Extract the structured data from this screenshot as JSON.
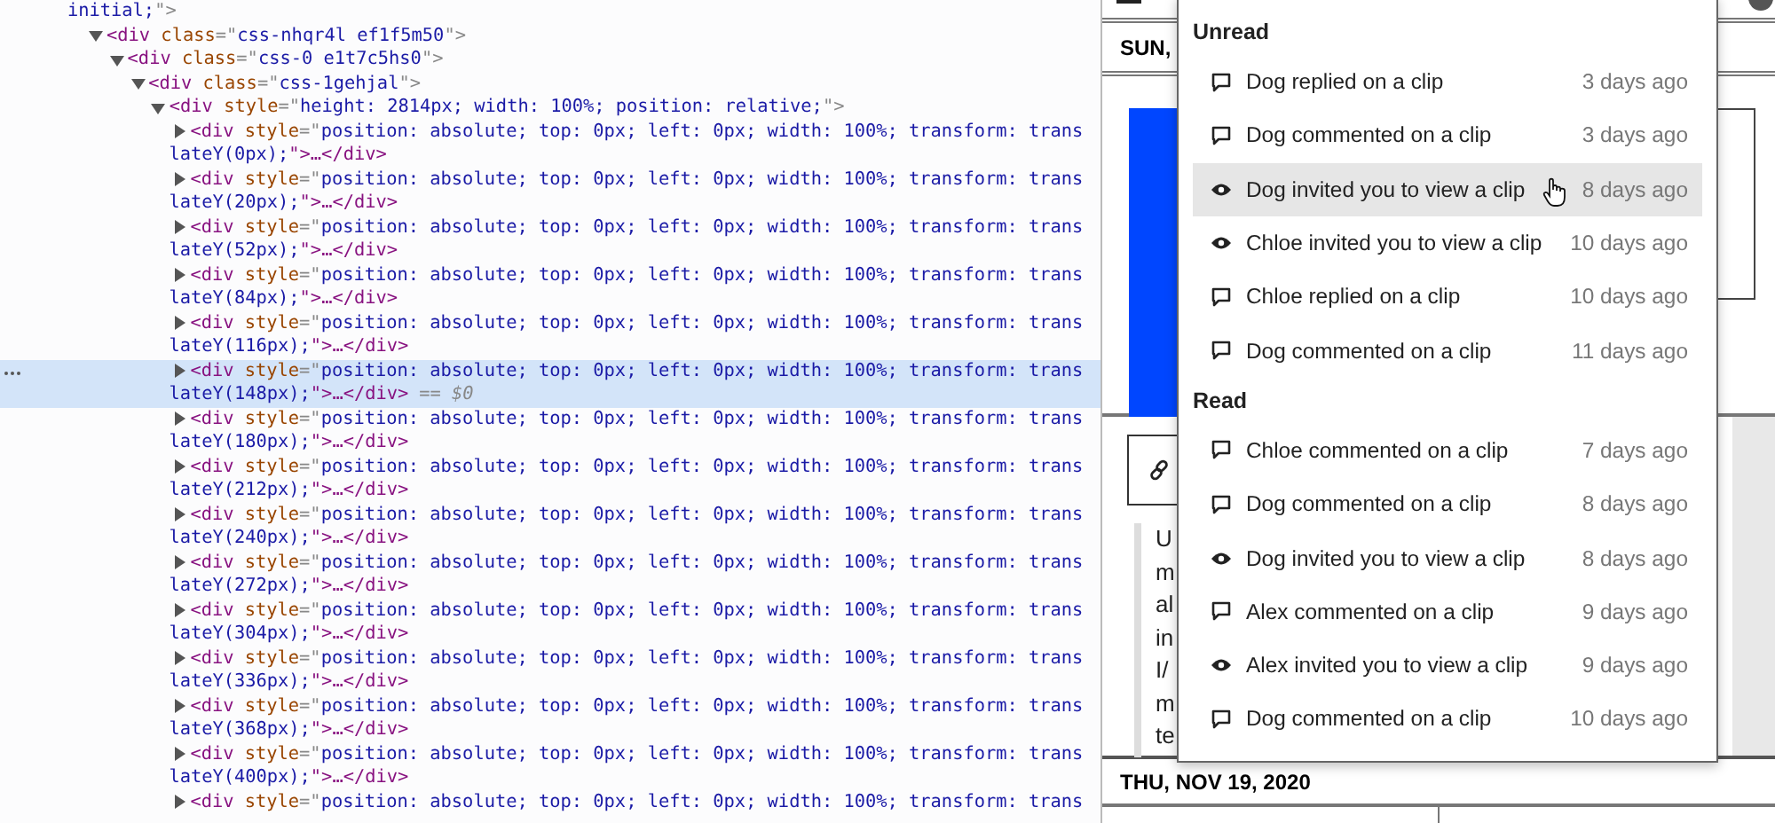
{
  "devtools": {
    "continuation": {
      "value": "initial;",
      "close": "\">"
    },
    "nodes": [
      {
        "tag": "<div",
        "attr": " class",
        "eq": "=\"",
        "value": "css-nhqr4l ef1f5m50",
        "close": "\">",
        "expanded": true,
        "selected": false,
        "children": [
          {
            "tag": "<div",
            "attr": " class",
            "eq": "=\"",
            "value": "css-0 e1t7c5hs0",
            "close": "\">",
            "expanded": true,
            "selected": false,
            "children": [
              {
                "tag": "<div",
                "attr": " class",
                "eq": "=\"",
                "value": "css-1gehjal",
                "close": "\">",
                "expanded": true,
                "selected": false,
                "children": [
                  {
                    "tag": "<div",
                    "attr": " style",
                    "eq": "=\"",
                    "value": "height: 2814px; width: 100%; position: relative;",
                    "close": "\">",
                    "expanded": true,
                    "selected": false,
                    "children": [
                      {
                        "tag": "<div",
                        "attr": " style",
                        "eq": "=\"",
                        "value": "position: absolute; top: 0px; left: 0px; width: 100%; transform: trans",
                        "wrap_value": "lateY(0px);",
                        "wrap_close": "\">…</div>",
                        "expanded": false,
                        "selected": false
                      },
                      {
                        "tag": "<div",
                        "attr": " style",
                        "eq": "=\"",
                        "value": "position: absolute; top: 0px; left: 0px; width: 100%; transform: trans",
                        "wrap_value": "lateY(20px);",
                        "wrap_close": "\">…</div>",
                        "expanded": false,
                        "selected": false
                      },
                      {
                        "tag": "<div",
                        "attr": " style",
                        "eq": "=\"",
                        "value": "position: absolute; top: 0px; left: 0px; width: 100%; transform: trans",
                        "wrap_value": "lateY(52px);",
                        "wrap_close": "\">…</div>",
                        "expanded": false,
                        "selected": false
                      },
                      {
                        "tag": "<div",
                        "attr": " style",
                        "eq": "=\"",
                        "value": "position: absolute; top: 0px; left: 0px; width: 100%; transform: trans",
                        "wrap_value": "lateY(84px);",
                        "wrap_close": "\">…</div>",
                        "expanded": false,
                        "selected": false
                      },
                      {
                        "tag": "<div",
                        "attr": " style",
                        "eq": "=\"",
                        "value": "position: absolute; top: 0px; left: 0px; width: 100%; transform: trans",
                        "wrap_value": "lateY(116px);",
                        "wrap_close": "\">…</div>",
                        "expanded": false,
                        "selected": false
                      },
                      {
                        "tag": "<div",
                        "attr": " style",
                        "eq": "=\"",
                        "value": "position: absolute; top: 0px; left: 0px; width: 100%; transform: trans",
                        "wrap_value": "lateY(148px);",
                        "wrap_close": "\">…</div>",
                        "marker": "== $0",
                        "expanded": false,
                        "selected": true
                      },
                      {
                        "tag": "<div",
                        "attr": " style",
                        "eq": "=\"",
                        "value": "position: absolute; top: 0px; left: 0px; width: 100%; transform: trans",
                        "wrap_value": "lateY(180px);",
                        "wrap_close": "\">…</div>",
                        "expanded": false,
                        "selected": false
                      },
                      {
                        "tag": "<div",
                        "attr": " style",
                        "eq": "=\"",
                        "value": "position: absolute; top: 0px; left: 0px; width: 100%; transform: trans",
                        "wrap_value": "lateY(212px);",
                        "wrap_close": "\">…</div>",
                        "expanded": false,
                        "selected": false
                      },
                      {
                        "tag": "<div",
                        "attr": " style",
                        "eq": "=\"",
                        "value": "position: absolute; top: 0px; left: 0px; width: 100%; transform: trans",
                        "wrap_value": "lateY(240px);",
                        "wrap_close": "\">…</div>",
                        "expanded": false,
                        "selected": false
                      },
                      {
                        "tag": "<div",
                        "attr": " style",
                        "eq": "=\"",
                        "value": "position: absolute; top: 0px; left: 0px; width: 100%; transform: trans",
                        "wrap_value": "lateY(272px);",
                        "wrap_close": "\">…</div>",
                        "expanded": false,
                        "selected": false
                      },
                      {
                        "tag": "<div",
                        "attr": " style",
                        "eq": "=\"",
                        "value": "position: absolute; top: 0px; left: 0px; width: 100%; transform: trans",
                        "wrap_value": "lateY(304px);",
                        "wrap_close": "\">…</div>",
                        "expanded": false,
                        "selected": false
                      },
                      {
                        "tag": "<div",
                        "attr": " style",
                        "eq": "=\"",
                        "value": "position: absolute; top: 0px; left: 0px; width: 100%; transform: trans",
                        "wrap_value": "lateY(336px);",
                        "wrap_close": "\">…</div>",
                        "expanded": false,
                        "selected": false
                      },
                      {
                        "tag": "<div",
                        "attr": " style",
                        "eq": "=\"",
                        "value": "position: absolute; top: 0px; left: 0px; width: 100%; transform: trans",
                        "wrap_value": "lateY(368px);",
                        "wrap_close": "\">…</div>",
                        "expanded": false,
                        "selected": false
                      },
                      {
                        "tag": "<div",
                        "attr": " style",
                        "eq": "=\"",
                        "value": "position: absolute; top: 0px; left: 0px; width: 100%; transform: trans",
                        "wrap_value": "lateY(400px);",
                        "wrap_close": "\">…</div>",
                        "expanded": false,
                        "selected": false
                      },
                      {
                        "tag": "<div",
                        "attr": " style",
                        "eq": "=\"",
                        "value": "position: absolute; top: 0px; left: 0px; width: 100%; transform: trans",
                        "expanded": false,
                        "selected": false
                      }
                    ]
                  }
                ]
              }
            ]
          }
        ]
      }
    ]
  },
  "page": {
    "top_date": "SUN,",
    "article_lines": [
      "U",
      "m",
      "al",
      "in",
      "I/",
      "m",
      "te"
    ],
    "bottom_date": "THU, NOV 19, 2020"
  },
  "notifications": {
    "sections": [
      {
        "title": "Unread",
        "items": [
          {
            "kind": "comment",
            "text": "Dog replied on a clip",
            "time": "3 days ago",
            "hovered": false
          },
          {
            "kind": "comment",
            "text": "Dog commented on a clip",
            "time": "3 days ago",
            "hovered": false
          },
          {
            "kind": "invite",
            "text": "Dog invited you to view a clip",
            "time": "8 days ago",
            "hovered": true
          },
          {
            "kind": "invite",
            "text": "Chloe invited you to view a clip",
            "time": "10 days ago",
            "hovered": false
          },
          {
            "kind": "comment",
            "text": "Chloe replied on a clip",
            "time": "10 days ago",
            "hovered": false
          },
          {
            "kind": "comment",
            "text": "Dog commented on a clip",
            "time": "11 days ago",
            "hovered": false
          }
        ]
      },
      {
        "title": "Read",
        "items": [
          {
            "kind": "comment",
            "text": "Chloe commented on a clip",
            "time": "7 days ago",
            "hovered": false
          },
          {
            "kind": "comment",
            "text": "Dog commented on a clip",
            "time": "8 days ago",
            "hovered": false
          },
          {
            "kind": "invite",
            "text": "Dog invited you to view a clip",
            "time": "8 days ago",
            "hovered": false
          },
          {
            "kind": "comment",
            "text": "Alex commented on a clip",
            "time": "9 days ago",
            "hovered": false
          },
          {
            "kind": "invite",
            "text": "Alex invited you to view a clip",
            "time": "9 days ago",
            "hovered": false
          },
          {
            "kind": "comment",
            "text": "Dog commented on a clip",
            "time": "10 days ago",
            "hovered": false
          }
        ]
      }
    ]
  }
}
